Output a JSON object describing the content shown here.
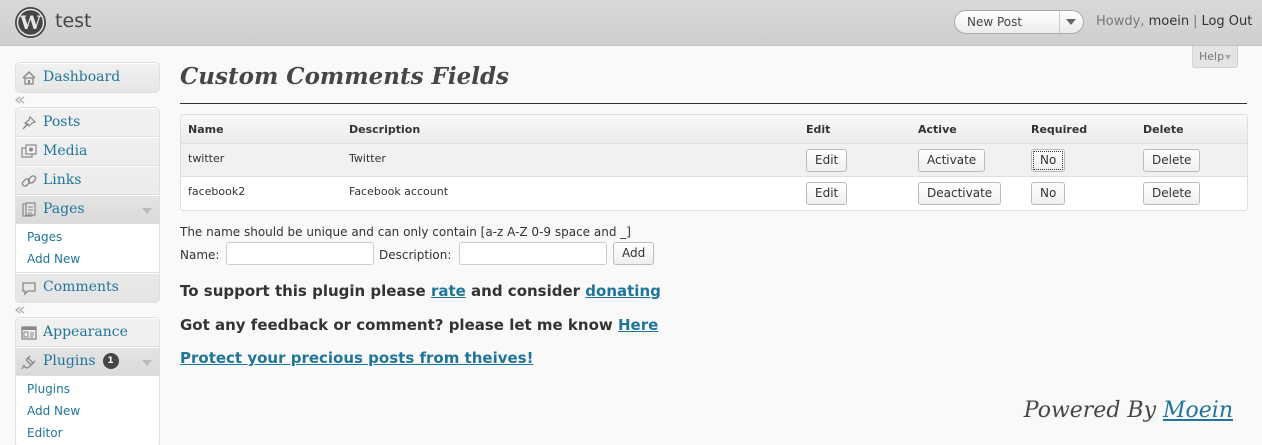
{
  "header": {
    "site_title": "test",
    "favorite_action": "New Post",
    "howdy": "Howdy,",
    "username": "moein",
    "separator": "|",
    "logout": "Log Out"
  },
  "help": {
    "label": "Help"
  },
  "sidebar": {
    "dashboard": "Dashboard",
    "posts": "Posts",
    "media": "Media",
    "links": "Links",
    "pages": "Pages",
    "pages_sub": [
      "Pages",
      "Add New"
    ],
    "comments": "Comments",
    "appearance": "Appearance",
    "plugins": "Plugins",
    "plugins_badge": "1",
    "plugins_sub": [
      "Plugins",
      "Add New",
      "Editor"
    ]
  },
  "main": {
    "title": "Custom Comments Fields",
    "table": {
      "headers": [
        "Name",
        "Description",
        "Edit",
        "Active",
        "Required",
        "Delete"
      ],
      "rows": [
        {
          "name": "twitter",
          "description": "Twitter",
          "edit": "Edit",
          "active": "Activate",
          "required": "No",
          "delete": "Delete"
        },
        {
          "name": "facebook2",
          "description": "Facebook account",
          "edit": "Edit",
          "active": "Deactivate",
          "required": "No",
          "delete": "Delete"
        }
      ]
    },
    "hint": "The name should be unique and can only contain [a-z A-Z 0-9 space and _]",
    "form": {
      "name_label": "Name:",
      "name_value": "",
      "description_label": "Description:",
      "description_value": "",
      "add_button": "Add"
    },
    "support": {
      "prefix": "To support this plugin please",
      "rate": "rate",
      "middle": "and consider",
      "donating": "donating"
    },
    "feedback": {
      "prefix": "Got any feedback or comment? please let me know",
      "here": "Here"
    },
    "protect": "Protect your precious posts from theives!",
    "powered": {
      "prefix": "Powered By",
      "author": "Moein"
    }
  }
}
